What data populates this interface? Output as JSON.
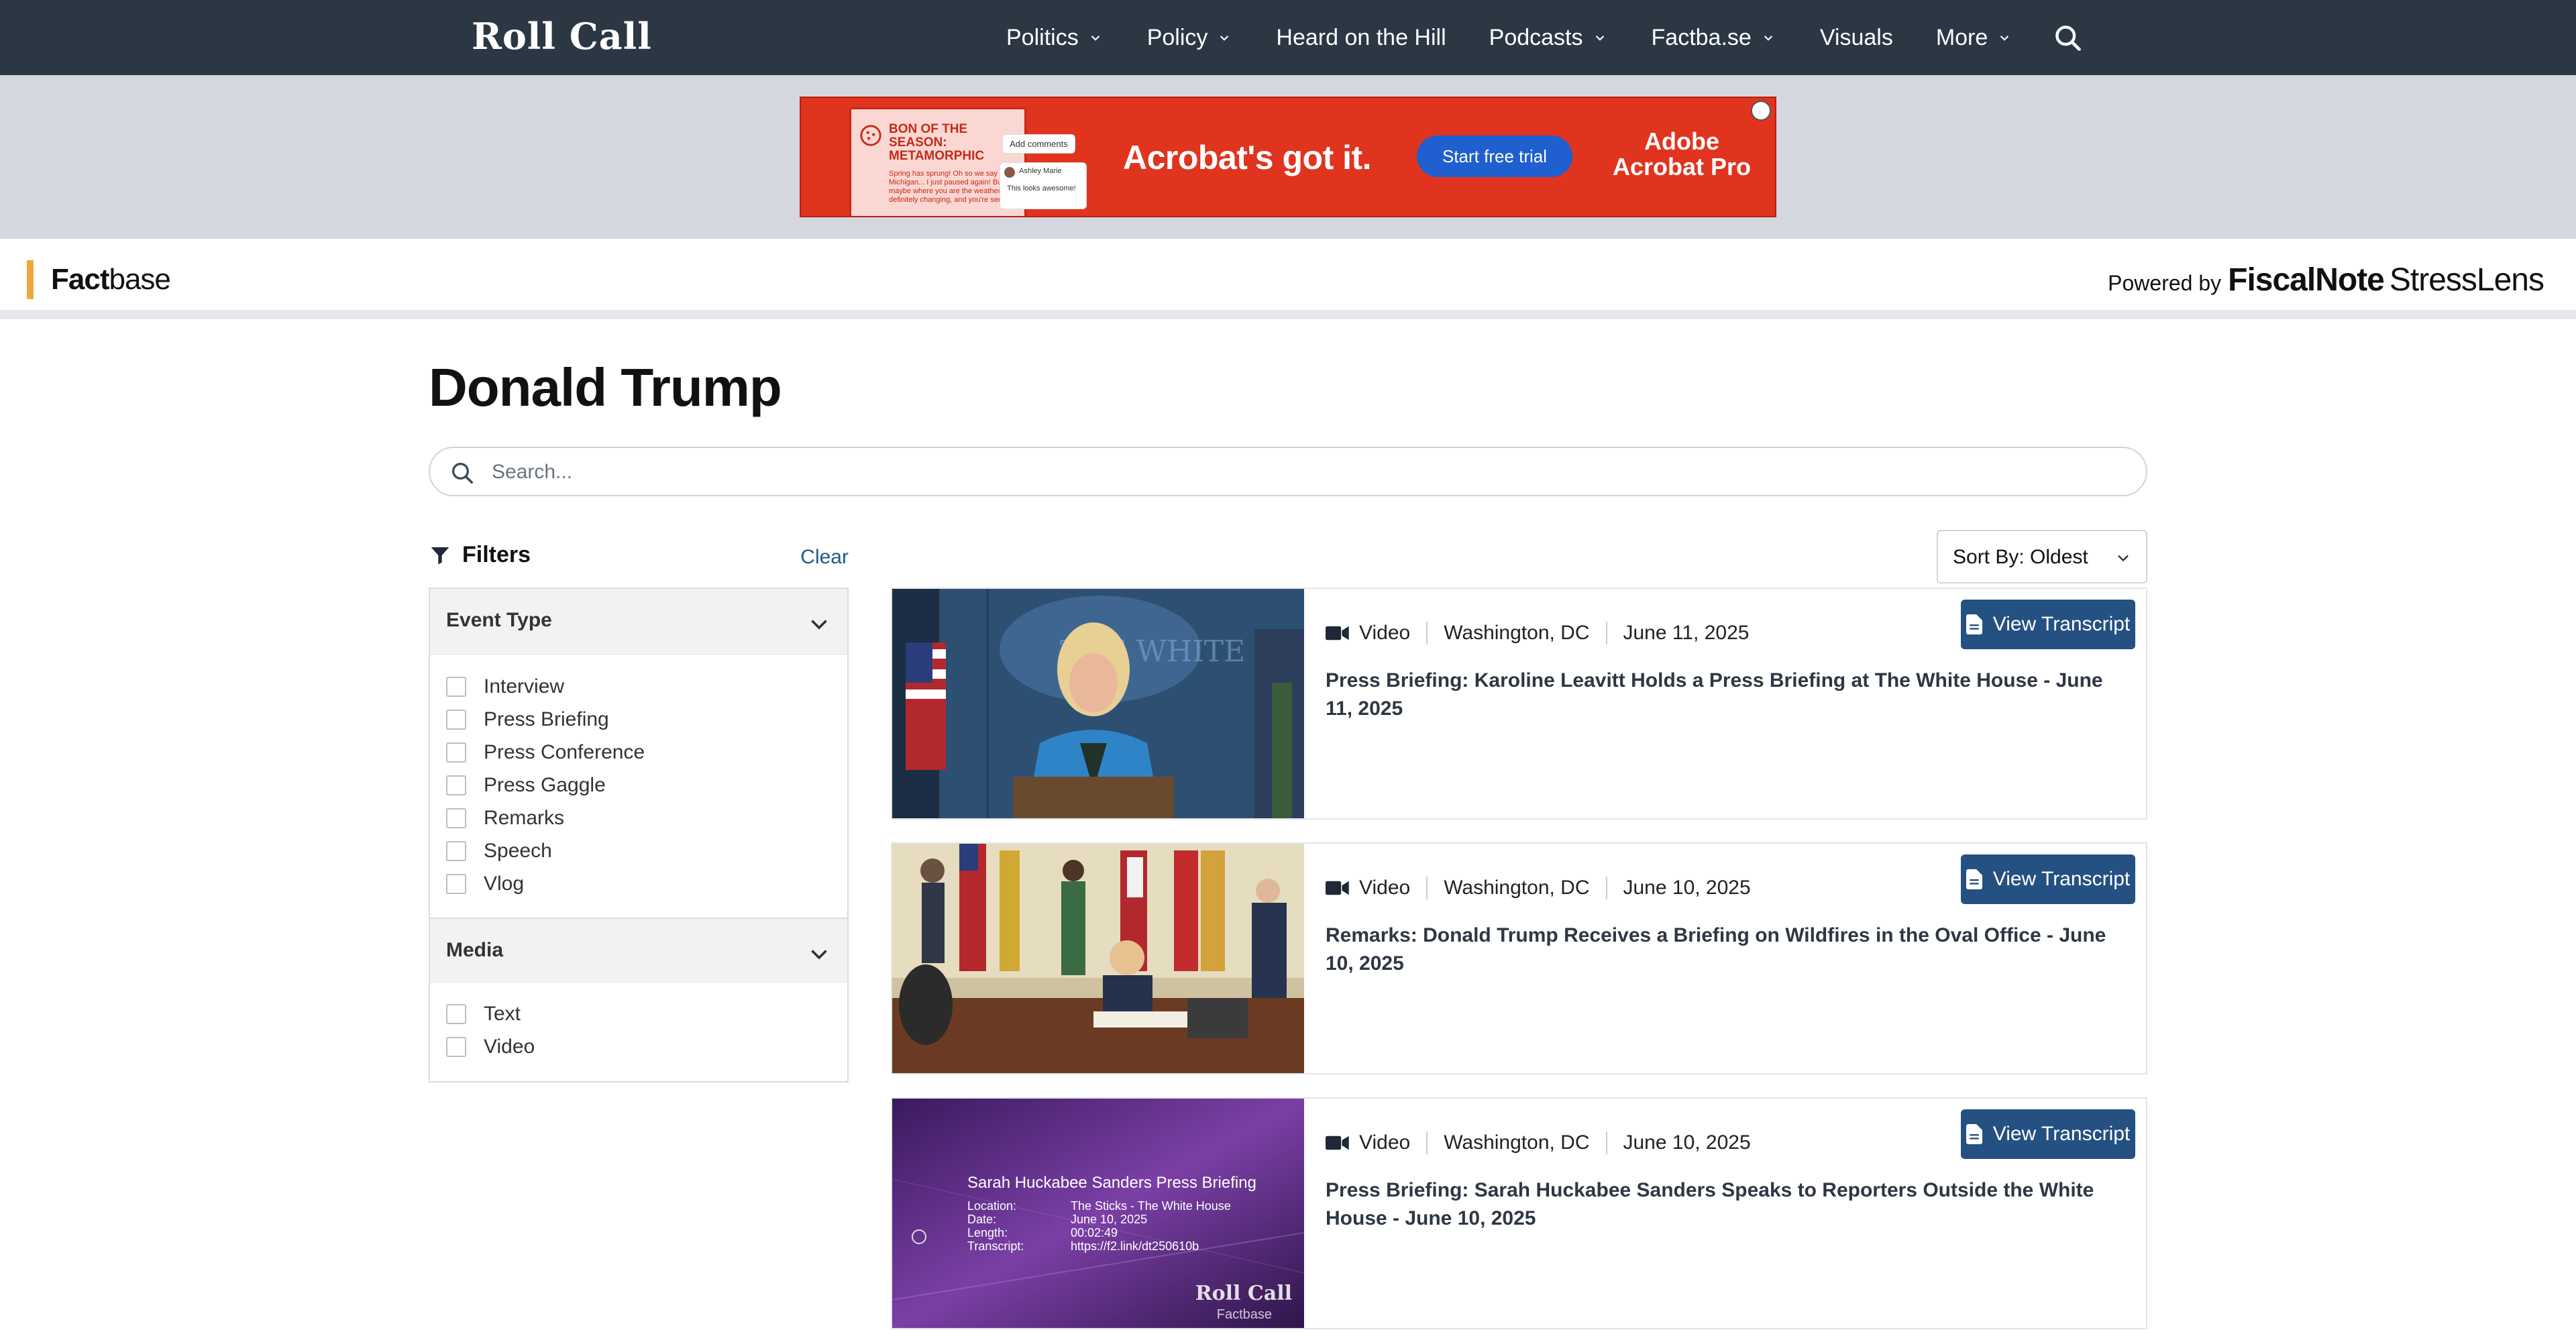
{
  "nav": {
    "logo": "Roll Call",
    "items": [
      {
        "label": "Politics",
        "has_menu": true
      },
      {
        "label": "Policy",
        "has_menu": true
      },
      {
        "label": "Heard on the Hill",
        "has_menu": false
      },
      {
        "label": "Podcasts",
        "has_menu": true
      },
      {
        "label": "Factba.se",
        "has_menu": true
      },
      {
        "label": "Visuals",
        "has_menu": false
      },
      {
        "label": "More",
        "has_menu": true
      }
    ]
  },
  "ad": {
    "card_title": "BON OF THE SEASON: METAMORPHIC",
    "card_body": "Spring has sprung! Oh so we say here in Michigan... I just paused again! But maybe where you are the weather is definitely changing, and you're seeing",
    "bubble_comment": "Add comments",
    "bubble_user": "Ashley Marie",
    "bubble_reply": "This looks awesome!",
    "headline": "Acrobat's got it.",
    "cta": "Start free trial",
    "brand_line1": "Adobe",
    "brand_line2": "Acrobat Pro"
  },
  "factbase": {
    "logo_bold": "Fact",
    "logo_light": "base",
    "powered_prefix": "Powered by",
    "powered_brand": "FiscalNote",
    "powered_product": "StressLens"
  },
  "page": {
    "title": "Donald Trump",
    "search_placeholder": "Search..."
  },
  "filters": {
    "title": "Filters",
    "clear": "Clear",
    "sections": [
      {
        "title": "Event Type",
        "options": [
          "Interview",
          "Press Briefing",
          "Press Conference",
          "Press Gaggle",
          "Remarks",
          "Speech",
          "Vlog"
        ]
      },
      {
        "title": "Media",
        "options": [
          "Text",
          "Video"
        ]
      }
    ]
  },
  "sort": {
    "label": "Sort By: Oldest"
  },
  "results": [
    {
      "media": "Video",
      "location": "Washington, DC",
      "date": "June 11, 2025",
      "title": "Press Briefing: Karoline Leavitt Holds a Press Briefing at The White House - June 11, 2025",
      "button": "View Transcript"
    },
    {
      "media": "Video",
      "location": "Washington, DC",
      "date": "June 10, 2025",
      "title": "Remarks: Donald Trump Receives a Briefing on Wildfires in the Oval Office - June 10, 2025",
      "button": "View Transcript"
    },
    {
      "media": "Video",
      "location": "Washington, DC",
      "date": "June 10, 2025",
      "title": "Press Briefing: Sarah Huckabee Sanders Speaks to Reporters Outside the White House - June 10, 2025",
      "button": "View Transcript",
      "thumb_overlay": {
        "title": "Sarah Huckabee Sanders Press Briefing",
        "rows": [
          {
            "label": "Location:",
            "value": "The Sticks - The White House"
          },
          {
            "label": "Date:",
            "value": "June 10, 2025"
          },
          {
            "label": "Length:",
            "value": "00:02:49"
          },
          {
            "label": "Transcript:",
            "value": "https://f2.link/dt250610b"
          }
        ],
        "brand": "Roll Call",
        "sub": "Factbase"
      }
    }
  ],
  "colors": {
    "nav_bg": "#2c3744",
    "accent": "#f2a73b",
    "button": "#245181",
    "link": "#1e5a8a",
    "ad_bg": "#e0341f"
  },
  "icons": {
    "search": "search-icon",
    "chevron": "chevron-down-icon",
    "filter": "filter-icon",
    "video": "video-camera-icon",
    "document": "document-icon"
  }
}
